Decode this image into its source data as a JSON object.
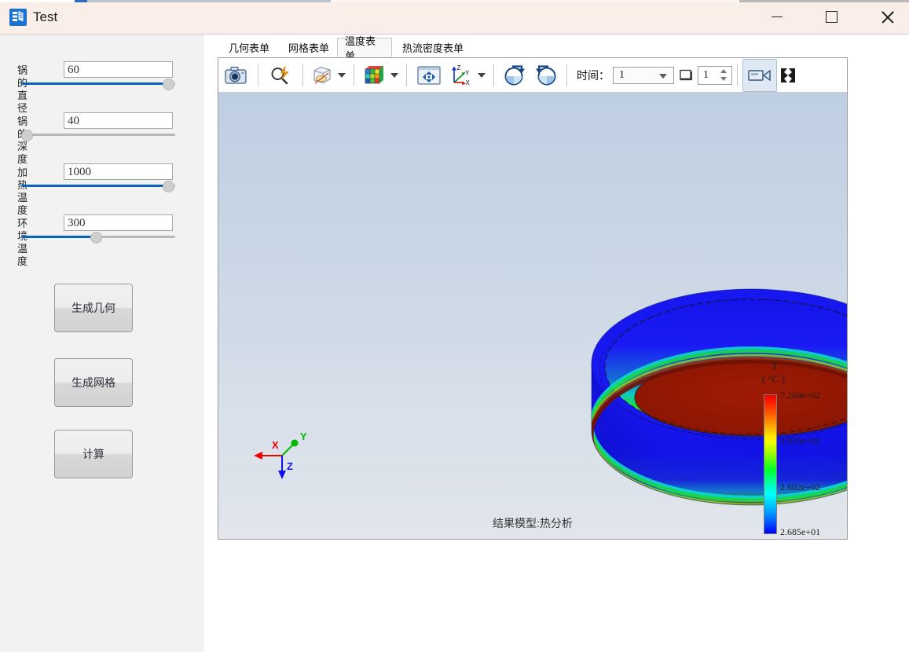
{
  "window": {
    "title": "Test",
    "icon": "app-stack-icon",
    "controls": {
      "minimize": "minimize-icon",
      "maximize": "maximize-icon",
      "close": "close-icon"
    },
    "titlebar_color": "#faeee8"
  },
  "left_panel": {
    "fields": [
      {
        "label": "锅的直径",
        "value": "60",
        "slider_percent": 95
      },
      {
        "label": "锅的深度",
        "value": "40",
        "slider_percent": 3
      },
      {
        "label": "加热温度",
        "value": "1000",
        "slider_percent": 95
      },
      {
        "label": "环境温度",
        "value": "300",
        "slider_percent": 48
      }
    ],
    "buttons": [
      {
        "label": "生成几何"
      },
      {
        "label": "生成网格"
      },
      {
        "label": "计算"
      }
    ]
  },
  "tabs": [
    {
      "label": "几何表单",
      "selected": false
    },
    {
      "label": "网格表单",
      "selected": false
    },
    {
      "label": "温度表单",
      "selected": true
    },
    {
      "label": "热流密度表单",
      "selected": false
    }
  ],
  "toolbar": {
    "items": [
      {
        "name": "screenshot-camera-icon",
        "type": "button"
      },
      {
        "name": "zoom-fit-icon",
        "type": "button"
      },
      {
        "name": "hide-geometry-icon",
        "type": "dropdown-button"
      },
      {
        "name": "colored-mesh-icon",
        "type": "dropdown-button"
      },
      {
        "name": "pan-move-icon",
        "type": "button"
      },
      {
        "name": "axis-orientation-icon",
        "type": "dropdown-button"
      },
      {
        "name": "rotate-cw-icon",
        "type": "button"
      },
      {
        "name": "rotate-ccw-icon",
        "type": "button"
      }
    ],
    "time_label": "时间：",
    "time_value": "1",
    "frame_icon": "frame-square-icon",
    "step_value": "1",
    "video_icon": "video-camera-icon",
    "fullscreen_icon": "expand-contrast-icon"
  },
  "viewer": {
    "caption": "结果模型:热分析",
    "background_top": "#becfe2",
    "background_bottom": "#e2e6ec",
    "axis": {
      "x_label": "X",
      "x_color": "#ff0000",
      "y_label": "Y",
      "y_color": "#00cc00",
      "z_label": "Z",
      "z_color": "#0000ff"
    },
    "legend": {
      "title": "T",
      "unit": "( °C )",
      "ticks": [
        "7.268e+02",
        "4.935e+02",
        "2.602e+02",
        "2.685e+01"
      ]
    }
  },
  "chart_data": {
    "type": "heatmap",
    "title": "结果模型:热分析",
    "colorbar_label": "T",
    "colorbar_unit": "°C",
    "colorbar_ticks": [
      726.8,
      493.5,
      260.2,
      26.85
    ],
    "vmin": 26.85,
    "vmax": 726.8,
    "colormap": "jet",
    "geometry": "pot / bowl (cylindrical vessel)",
    "description": "Thermal analysis result: interior bottom surface near maximum temperature (dark red), outer wall near minimum temperature (blue), with cyan-green-yellow transition bands at the inner wall and lower outer rim."
  }
}
